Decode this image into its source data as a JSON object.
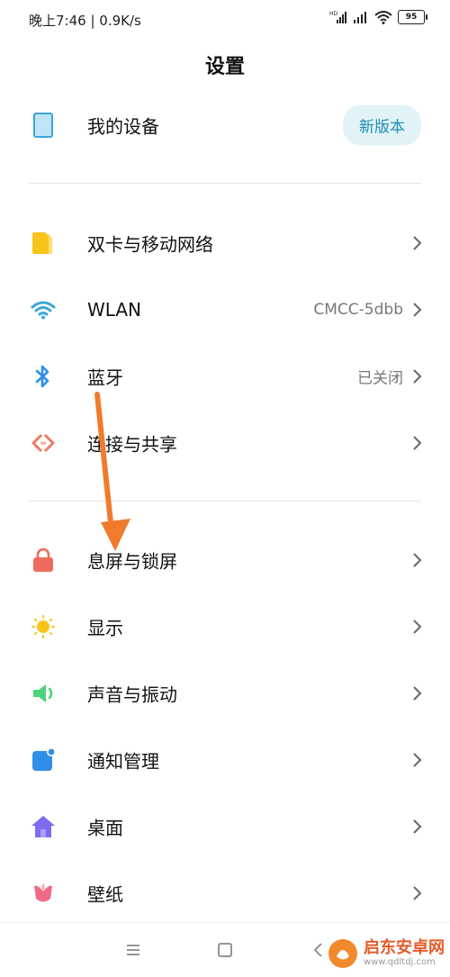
{
  "status": {
    "left": "晚上7:46 | 0.9K/s",
    "battery": "95"
  },
  "page": {
    "title": "设置"
  },
  "sections": {
    "device": {
      "label": "我的设备",
      "badge": "新版本"
    },
    "network": [
      {
        "label": "双卡与移动网络",
        "value": "",
        "icon": "sim-card-icon"
      },
      {
        "label": "WLAN",
        "value": "CMCC-5dbb",
        "icon": "wifi-icon"
      },
      {
        "label": "蓝牙",
        "value": "已关闭",
        "icon": "bluetooth-icon"
      },
      {
        "label": "连接与共享",
        "value": "",
        "icon": "connection-share-icon"
      }
    ],
    "personal": [
      {
        "label": "息屏与锁屏",
        "icon": "lock-icon"
      },
      {
        "label": "显示",
        "icon": "sun-icon"
      },
      {
        "label": "声音与振动",
        "icon": "speaker-icon"
      },
      {
        "label": "通知管理",
        "icon": "notification-icon"
      },
      {
        "label": "桌面",
        "icon": "home-icon"
      },
      {
        "label": "壁纸",
        "icon": "flower-icon"
      }
    ]
  },
  "watermark": {
    "line1": "启东安卓网",
    "line2": "www.qdltdj.com"
  },
  "colors": {
    "accent_badge_bg": "#e2f3f8",
    "accent_badge_text": "#1b8db2",
    "annotation_arrow": "#f07b2c"
  }
}
